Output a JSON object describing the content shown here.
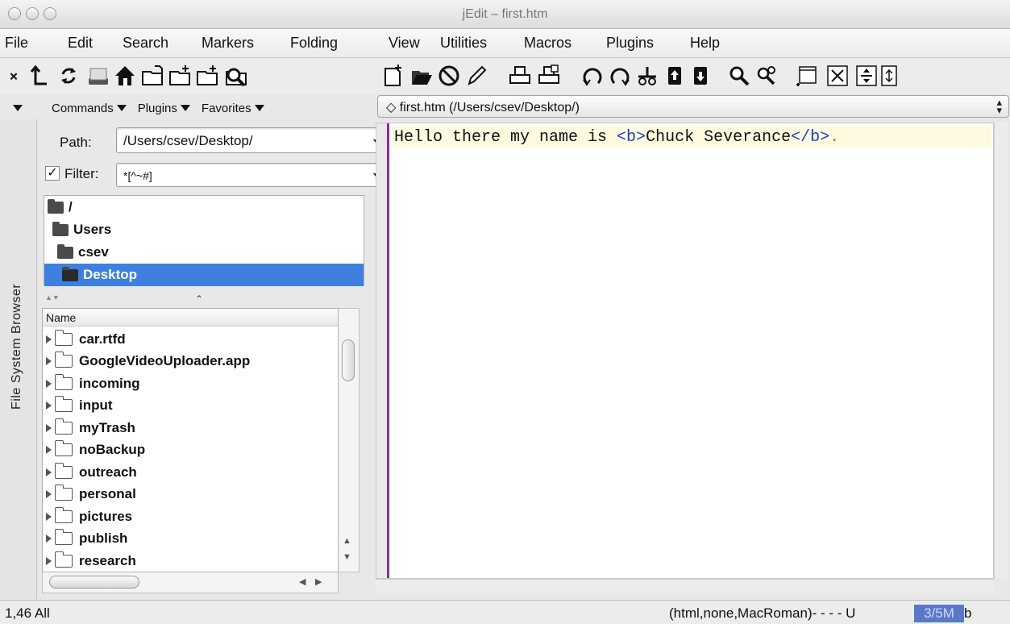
{
  "window": {
    "title": "jEdit – first.htm"
  },
  "menu": [
    "File",
    "Edit",
    "Search",
    "Markers",
    "Folding",
    "View",
    "Utilities",
    "Macros",
    "Plugins",
    "Help"
  ],
  "toolbar": {
    "left_icons": [
      "close-dock-icon",
      "parent-directory-icon",
      "reload-icon",
      "roots-icon",
      "home-icon",
      "new-file-icon",
      "new-file-icon",
      "new-directory-icon",
      "search-icon"
    ],
    "right_icons": [
      "new-file-icon",
      "open-file-icon",
      "close-file-icon",
      "edit-icon",
      "print-icon",
      "page-setup-icon",
      "undo-icon",
      "redo-icon",
      "cut-icon",
      "copy-icon",
      "paste-icon",
      "find-icon",
      "find-next-icon",
      "window-icon",
      "split-icon",
      "unsplit-icon",
      "scroll-icon"
    ]
  },
  "browser": {
    "dock_title": "File System Browser",
    "commands_label": "Commands",
    "plugins_label": "Plugins",
    "favorites_label": "Favorites",
    "path_label": "Path:",
    "path_value": "/Users/csev/Desktop/",
    "filter_label": "Filter:",
    "filter_value": "*[^~#]",
    "filter_checked": true,
    "tree": [
      {
        "label": "/",
        "selected": false
      },
      {
        "label": "Users",
        "selected": false
      },
      {
        "label": "csev",
        "selected": false
      },
      {
        "label": "Desktop",
        "selected": true
      }
    ],
    "files_header": "Name",
    "files": [
      "car.rtfd",
      "GoogleVideoUploader.app",
      "incoming",
      "input",
      "myTrash",
      "noBackup",
      "outreach",
      "personal",
      "pictures",
      "publish",
      "research"
    ]
  },
  "buffer": {
    "switcher": "first.htm (/Users/csev/Desktop/)",
    "line_text": "Hello there my name is ",
    "tag_open": "<b>",
    "bold_text": "Chuck Severance",
    "tag_close": "</b>",
    "trailing": "."
  },
  "status": {
    "position": "1,46 All",
    "mode": "(html,none,MacRoman)- - - - U",
    "memory": "3/5M",
    "memory_tail": "b"
  },
  "colors": {
    "selection": "#3d80df",
    "gutter_border": "#8a2a9c",
    "tag": "#1e3cc8",
    "current_line": "#fefae0"
  }
}
